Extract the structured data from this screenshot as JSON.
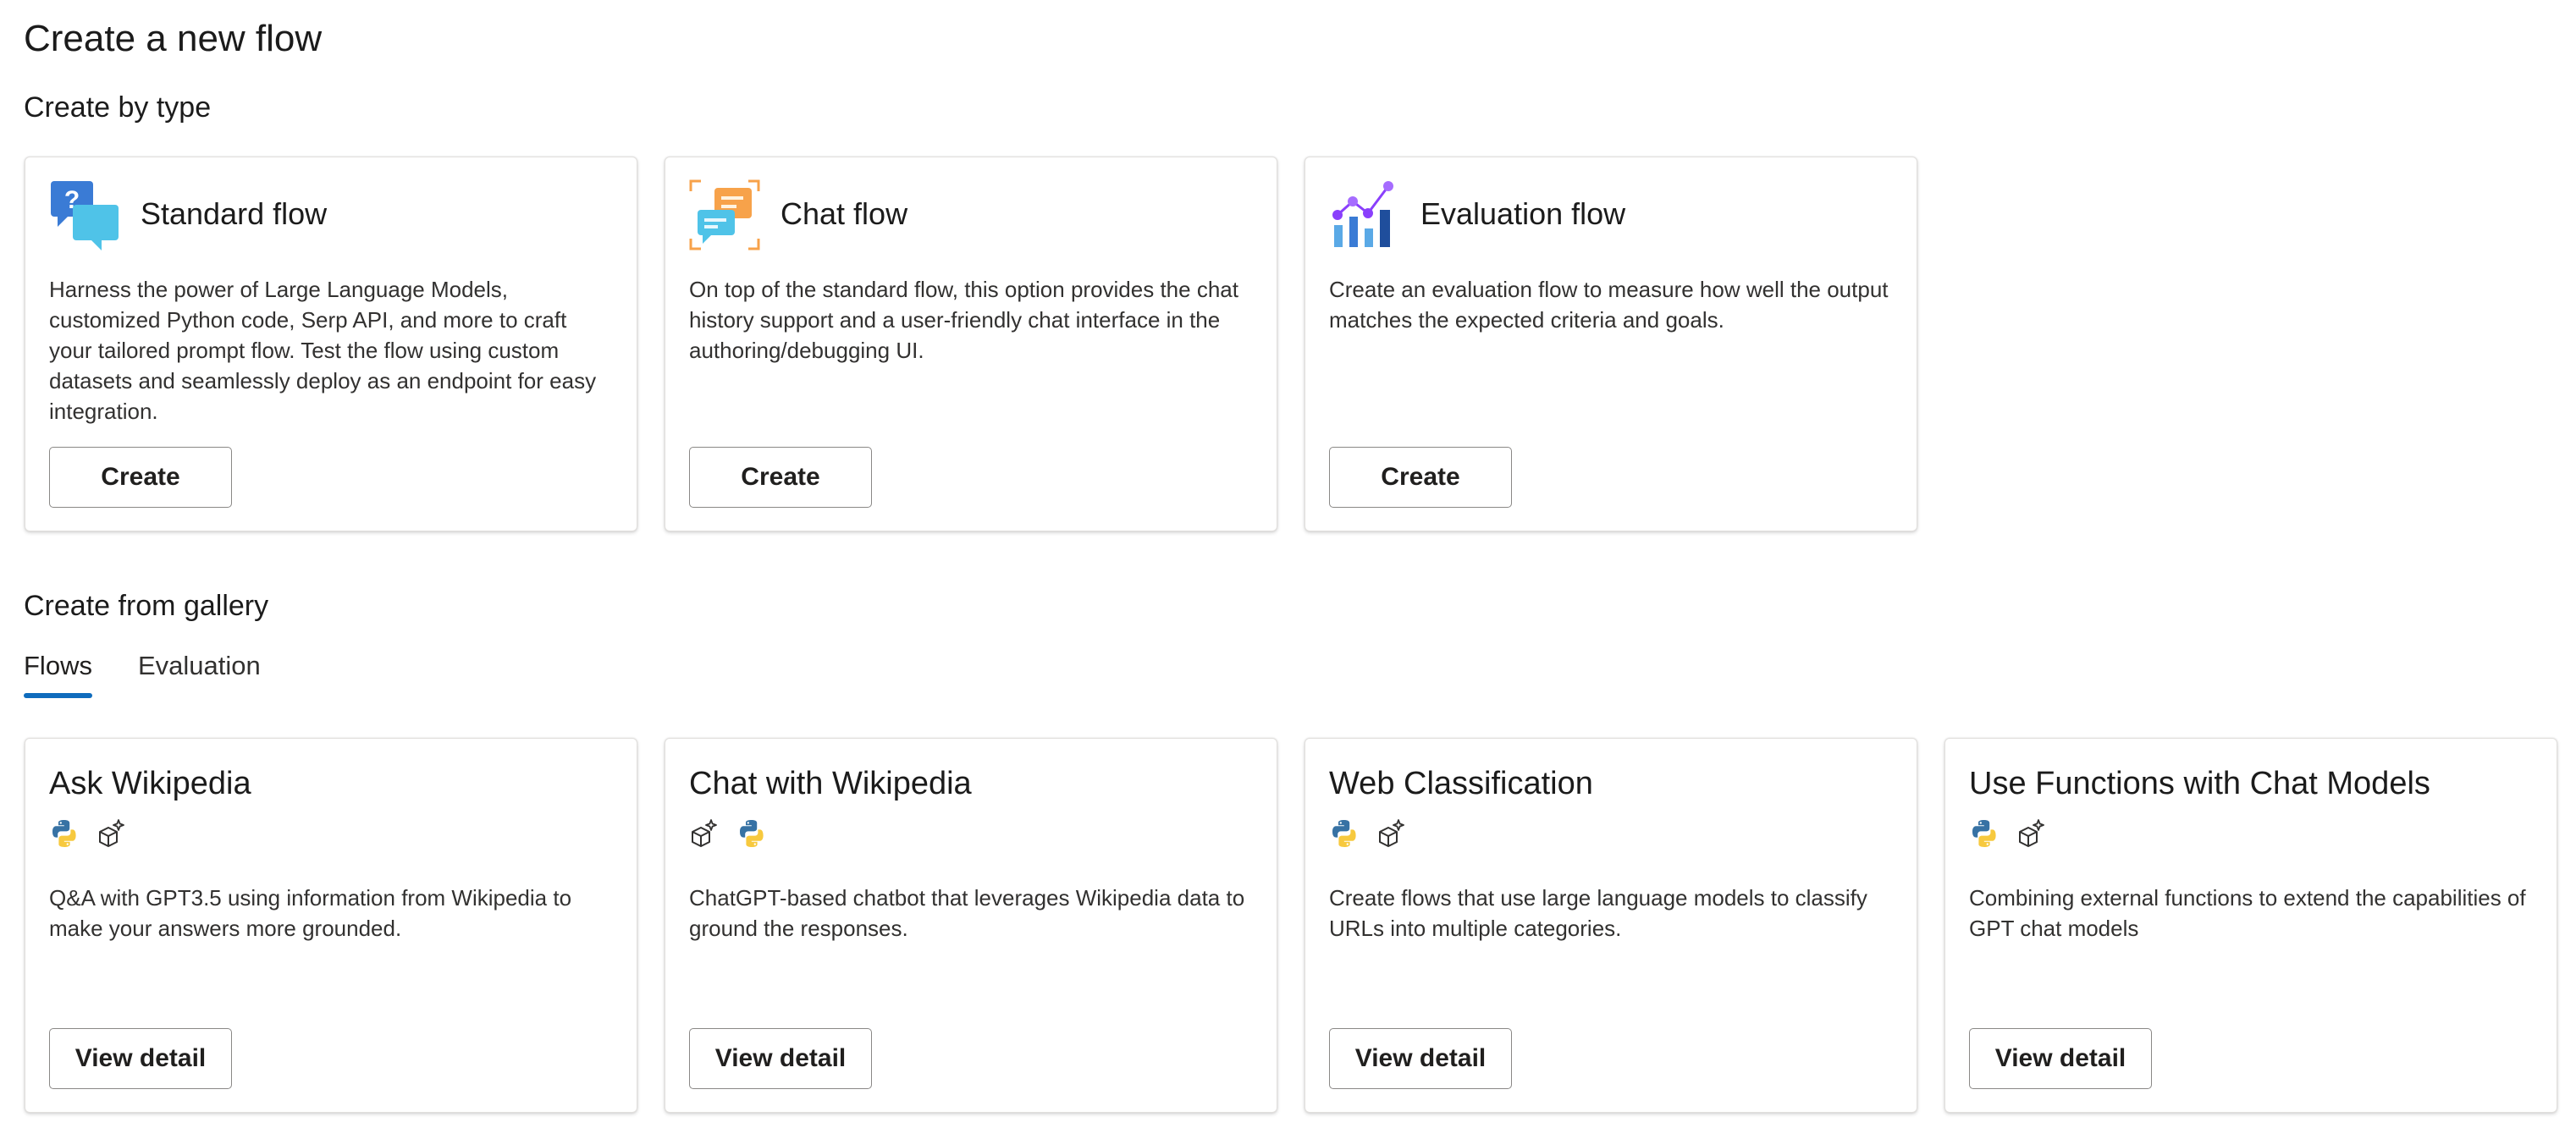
{
  "page": {
    "title": "Create a new flow"
  },
  "create_by_type": {
    "heading": "Create by type",
    "cards": [
      {
        "title": "Standard flow",
        "icon": "standard-flow-icon",
        "description": "Harness the power of Large Language Models, customized Python code, Serp API, and more to craft your tailored prompt flow. Test the flow using custom datasets and seamlessly deploy as an endpoint for easy integration.",
        "button": "Create"
      },
      {
        "title": "Chat flow",
        "icon": "chat-flow-icon",
        "description": "On top of the standard flow, this option provides the chat history support and a user-friendly chat interface in the authoring/debugging UI.",
        "button": "Create"
      },
      {
        "title": "Evaluation flow",
        "icon": "evaluation-flow-icon",
        "description": "Create an evaluation flow to measure how well the output matches the expected criteria and goals.",
        "button": "Create"
      }
    ]
  },
  "gallery": {
    "heading": "Create from gallery",
    "tabs": [
      {
        "label": "Flows",
        "active": true
      },
      {
        "label": "Evaluation",
        "active": false
      }
    ],
    "cards": [
      {
        "title": "Ask Wikipedia",
        "badges": [
          "python-icon",
          "sparkle-cube-icon"
        ],
        "description": "Q&A with GPT3.5 using information from Wikipedia to make your answers more grounded.",
        "button": "View detail"
      },
      {
        "title": "Chat with Wikipedia",
        "badges": [
          "sparkle-cube-icon",
          "python-icon"
        ],
        "description": "ChatGPT-based chatbot that leverages Wikipedia data to ground the responses.",
        "button": "View detail"
      },
      {
        "title": "Web Classification",
        "badges": [
          "python-icon",
          "sparkle-cube-icon"
        ],
        "description": "Create flows that use large language models to classify URLs into multiple categories.",
        "button": "View detail"
      },
      {
        "title": "Use Functions with Chat Models",
        "badges": [
          "python-icon",
          "sparkle-cube-icon"
        ],
        "description": "Combining external functions to extend the capabilities of GPT chat models",
        "button": "View detail"
      }
    ]
  },
  "colors": {
    "accent": "#0f6cbd",
    "python_blue": "#3772a4",
    "python_yellow": "#f7c93e",
    "chat_orange": "#f7a24a",
    "chat_cyan": "#4fc3e8",
    "eval_purple": "#8a3ffc"
  }
}
